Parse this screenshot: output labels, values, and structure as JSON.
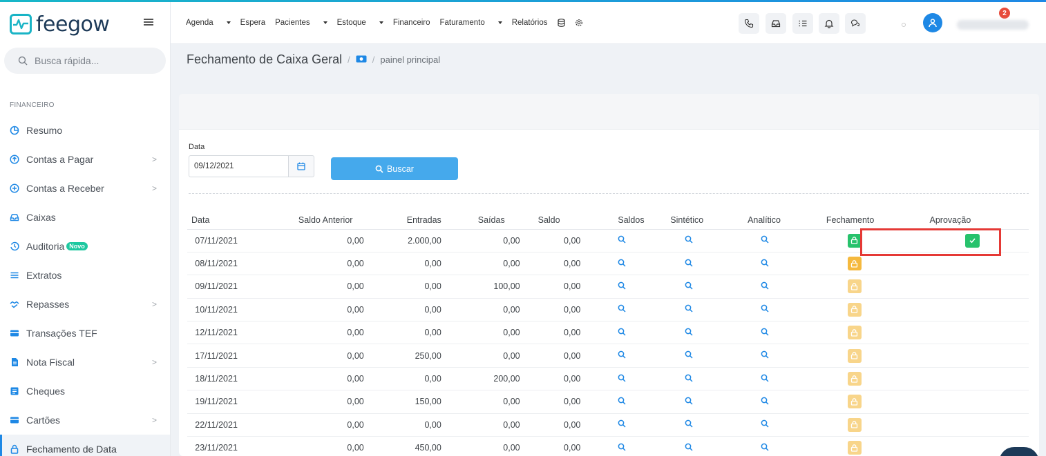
{
  "app": {
    "logo_text": "feegow"
  },
  "sidebar": {
    "search_placeholder": "Busca rápida...",
    "section_title": "FINANCEIRO",
    "items": [
      {
        "label": "Resumo",
        "icon": "pie-chart-icon",
        "has_children": false
      },
      {
        "label": "Contas a Pagar",
        "icon": "arrow-up-circle-icon",
        "has_children": true
      },
      {
        "label": "Contas a Receber",
        "icon": "arrow-down-circle-icon",
        "has_children": true
      },
      {
        "label": "Caixas",
        "icon": "inbox-icon",
        "has_children": false
      },
      {
        "label": "Auditoria",
        "icon": "history-icon",
        "badge": "Novo",
        "has_children": false
      },
      {
        "label": "Extratos",
        "icon": "list-icon",
        "has_children": false
      },
      {
        "label": "Repasses",
        "icon": "handshake-icon",
        "has_children": true
      },
      {
        "label": "Transações TEF",
        "icon": "card-icon",
        "has_children": false
      },
      {
        "label": "Nota Fiscal",
        "icon": "document-icon",
        "has_children": true
      },
      {
        "label": "Cheques",
        "icon": "check-doc-icon",
        "has_children": false
      },
      {
        "label": "Cartões",
        "icon": "card-icon",
        "has_children": true
      },
      {
        "label": "Fechamento de Data",
        "icon": "lock-icon",
        "has_children": false,
        "active": true
      }
    ]
  },
  "topnav": {
    "menu": [
      {
        "label": "Agenda",
        "dropdown": true
      },
      {
        "label": "Espera",
        "dropdown": false
      },
      {
        "label": "Pacientes",
        "dropdown": true
      },
      {
        "label": "Estoque",
        "dropdown": true
      },
      {
        "label": "Financeiro",
        "dropdown": false
      },
      {
        "label": "Faturamento",
        "dropdown": true
      },
      {
        "label": "Relatórios",
        "dropdown": false
      }
    ],
    "notification_count": "2"
  },
  "breadcrumb": {
    "title": "Fechamento de Caixa Geral",
    "separator": "/",
    "sub": "painel principal"
  },
  "filter": {
    "date_label": "Data",
    "date_value": "09/12/2021",
    "search_button": "Buscar"
  },
  "table": {
    "headers": [
      "Data",
      "Saldo Anterior",
      "Entradas",
      "Saídas",
      "Saldo",
      "Saldos",
      "Sintético",
      "Analítico",
      "Fechamento",
      "Aprovação"
    ],
    "rows": [
      {
        "date": "07/11/2021",
        "saldo_anterior": "0,00",
        "entradas": "2.000,00",
        "saidas": "0,00",
        "saldo": "0,00",
        "fechamento": "closed",
        "aprovacao": "approved"
      },
      {
        "date": "08/11/2021",
        "saldo_anterior": "0,00",
        "entradas": "0,00",
        "saidas": "0,00",
        "saldo": "0,00",
        "fechamento": "open-current",
        "aprovacao": ""
      },
      {
        "date": "09/11/2021",
        "saldo_anterior": "0,00",
        "entradas": "0,00",
        "saidas": "100,00",
        "saldo": "0,00",
        "fechamento": "open",
        "aprovacao": ""
      },
      {
        "date": "10/11/2021",
        "saldo_anterior": "0,00",
        "entradas": "0,00",
        "saidas": "0,00",
        "saldo": "0,00",
        "fechamento": "open",
        "aprovacao": ""
      },
      {
        "date": "12/11/2021",
        "saldo_anterior": "0,00",
        "entradas": "0,00",
        "saidas": "0,00",
        "saldo": "0,00",
        "fechamento": "open",
        "aprovacao": ""
      },
      {
        "date": "17/11/2021",
        "saldo_anterior": "0,00",
        "entradas": "250,00",
        "saidas": "0,00",
        "saldo": "0,00",
        "fechamento": "open",
        "aprovacao": ""
      },
      {
        "date": "18/11/2021",
        "saldo_anterior": "0,00",
        "entradas": "0,00",
        "saidas": "200,00",
        "saldo": "0,00",
        "fechamento": "open",
        "aprovacao": ""
      },
      {
        "date": "19/11/2021",
        "saldo_anterior": "0,00",
        "entradas": "150,00",
        "saidas": "0,00",
        "saldo": "0,00",
        "fechamento": "open",
        "aprovacao": ""
      },
      {
        "date": "22/11/2021",
        "saldo_anterior": "0,00",
        "entradas": "0,00",
        "saidas": "0,00",
        "saldo": "0,00",
        "fechamento": "open",
        "aprovacao": ""
      },
      {
        "date": "23/11/2021",
        "saldo_anterior": "0,00",
        "entradas": "450,00",
        "saidas": "0,00",
        "saldo": "0,00",
        "fechamento": "open",
        "aprovacao": ""
      }
    ]
  },
  "colors": {
    "accent": "#1e88e5",
    "brand": "#19b4c6",
    "closed_lock": "#27c26c",
    "open_lock": "#f8d58a",
    "current_lock": "#f5b93e",
    "highlight": "#e53935"
  }
}
